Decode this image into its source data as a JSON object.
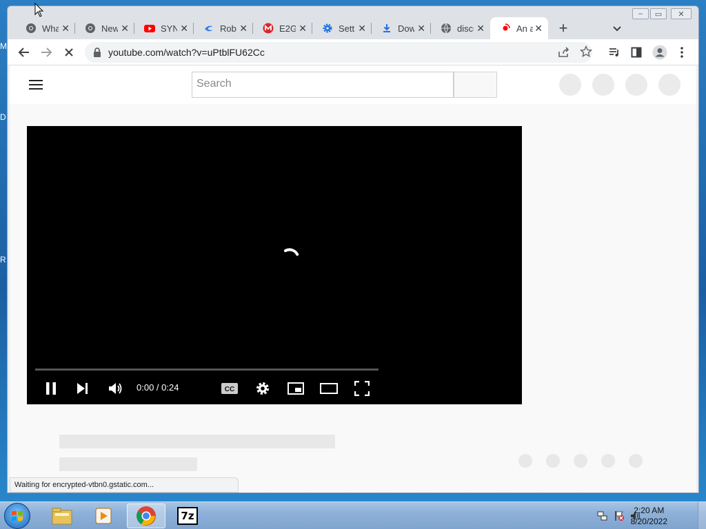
{
  "browser": {
    "tabs": [
      {
        "title": "WhatsApp",
        "icon": "chrome-icon"
      },
      {
        "title": "New Tab",
        "icon": "chrome-icon"
      },
      {
        "title": "SYNTH",
        "icon": "youtube-icon"
      },
      {
        "title": "Robot",
        "icon": "swirl-icon"
      },
      {
        "title": "E2G",
        "icon": "mega-icon"
      },
      {
        "title": "Settings",
        "icon": "gear-icon"
      },
      {
        "title": "Downloads",
        "icon": "download-icon"
      },
      {
        "title": "discord",
        "icon": "globe-icon"
      },
      {
        "title": "An a",
        "icon": "youtube-loading-icon",
        "active": true
      }
    ],
    "url": "youtube.com/watch?v=uPtblFU62Cc",
    "status_text": "Waiting for encrypted-vtbn0.gstatic.com..."
  },
  "youtube": {
    "search_placeholder": "Search",
    "player": {
      "time": "0:00 / 0:24",
      "progress": 0
    }
  },
  "taskbar": {
    "time": "2:20 AM",
    "date": "8/20/2022",
    "apps": [
      "windows-explorer-icon",
      "media-player-icon",
      "chrome-icon",
      "7zip-icon"
    ],
    "sevenzip_label": "7z"
  },
  "desktop": {
    "edge_glyphs": [
      "M",
      "D",
      "R"
    ]
  }
}
